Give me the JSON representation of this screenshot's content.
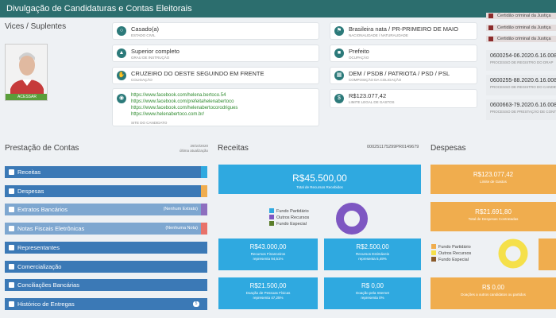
{
  "header": {
    "title": "Divulgação de Candidaturas e Contas Eleitorais"
  },
  "vices": {
    "title": "Vices / Suplentes",
    "photo_button": "ACESSAR"
  },
  "info_cards": [
    {
      "value": "Casado(a)",
      "label": "ESTADO CIVIL",
      "icon": "ring-icon"
    },
    {
      "value": "Brasileira nata / PR-PRIMEIRO DE MAIO",
      "label": "NACIONALIDADE / NATURALIDADE",
      "icon": "flag-icon"
    },
    {
      "value": "Superior completo",
      "label": "GRAU DE INSTRUÇÃO",
      "icon": "graduation-icon"
    },
    {
      "value": "Prefeito",
      "label": "OCUPAÇÃO",
      "icon": "briefcase-icon"
    },
    {
      "value": "CRUZEIRO DO OESTE SEGUINDO EM FRENTE",
      "label": "COLIGAÇÃO",
      "icon": "handshake-icon"
    },
    {
      "value": "DEM / PSDB / PATRIOTA / PSD / PSL",
      "label": "COMPOSIÇÃO DA COLIGAÇÃO",
      "icon": "building-icon"
    },
    {
      "value": "R$123.077,42",
      "label": "LIMITE LEGAL DE GASTOS",
      "icon": "money-icon"
    }
  ],
  "sites": {
    "links": [
      "https://www.facebook.com/helena.bertoco.54",
      "https://www.facebook.com/prefeitahelenabertoco",
      "https://www.facebook.com/helenabertocorodrigues",
      "https://www.helenabertoco.com.br/"
    ],
    "label": "SITE DO CANDIDATO"
  },
  "certidoes": [
    "Certidão criminal da Justiça",
    "Certidão criminal da Justiça",
    "Certidão criminal da Justiça"
  ],
  "processos": [
    {
      "number": "0600254-06.2020.6.16.008",
      "label": "PROCESSO DE REGISTRO DO DRAP"
    },
    {
      "number": "0600255-88.2020.6.16.008",
      "label": "PROCESSO DE REGISTRO DO CANDIDATO"
    },
    {
      "number": "0600663-79.2020.6.16.008",
      "label": "PROCESSO DE PRESTAÇÃO DE CONTAS"
    }
  ],
  "prestacao": {
    "title": "Prestação de Contas",
    "update_date": "29/10/2020",
    "update_label": "última atualização",
    "items": [
      {
        "label": "Receitas",
        "note": "",
        "strip_color": "#2fa9e0",
        "light": false,
        "badge": ""
      },
      {
        "label": "Despesas",
        "note": "",
        "strip_color": "#f0ad4e",
        "light": false,
        "badge": ""
      },
      {
        "label": "Extratos Bancários",
        "note": "(Nenhum Extrato)",
        "strip_color": "#8e6fbf",
        "light": true,
        "badge": ""
      },
      {
        "label": "Notas Fiscais Eletrônicas",
        "note": "(Nenhuma Nota)",
        "strip_color": "#e8726a",
        "light": true,
        "badge": ""
      },
      {
        "label": "Representantes",
        "note": "",
        "strip_color": "",
        "light": false,
        "badge": ""
      },
      {
        "label": "Comercialização",
        "note": "",
        "strip_color": "",
        "light": false,
        "badge": ""
      },
      {
        "label": "Conciliações Bancárias",
        "note": "",
        "strip_color": "",
        "light": false,
        "badge": ""
      },
      {
        "label": "Histórico de Entregas",
        "note": "",
        "strip_color": "",
        "light": false,
        "badge": "5"
      }
    ]
  },
  "receitas": {
    "title": "Receitas",
    "code": "000251175299PR0149679",
    "total": {
      "amount": "R$45.500,00",
      "label": "Total de Recursos Recebidos"
    },
    "legend": [
      {
        "name": "Fundo Partidário",
        "color": "#2fa9e0"
      },
      {
        "name": "Outros Recursos",
        "color": "#7e57c2"
      },
      {
        "name": "Fundo Especial",
        "color": "#5a7d2a"
      }
    ],
    "pie_share": {
      "outros_recursos": 100
    },
    "boxes": [
      {
        "amount": "R$43.000,00",
        "line1": "Recursos Financeiros",
        "line2": "representa 94,51%"
      },
      {
        "amount": "R$2.500,00",
        "line1": "Recursos Estimáveis",
        "line2": "representa 5,49%"
      },
      {
        "amount": "R$21.500,00",
        "line1": "Doação de Pessoas Físicas",
        "line2": "representa 47,25%"
      },
      {
        "amount": "R$ 0,00",
        "line1": "Doação pela Internet",
        "line2": "representa 0%"
      }
    ]
  },
  "despesas": {
    "title": "Despesas",
    "limit": {
      "amount": "R$123.077,42",
      "label": "Limite de Gastos"
    },
    "total": {
      "amount": "R$21.691,80",
      "label": "Total de Despesas Contratadas"
    },
    "legend": [
      {
        "name": "Fundo Partidário",
        "color": "#f0ad4e"
      },
      {
        "name": "Outros Recursos",
        "color": "#f5e04a"
      },
      {
        "name": "Fundo Especial",
        "color": "#8a5a2a"
      }
    ],
    "pie_share": {
      "outros_recursos": 100
    },
    "doacoes": {
      "amount": "R$ 0,00",
      "label": "Doações a outros candidatos ou partidos"
    }
  }
}
